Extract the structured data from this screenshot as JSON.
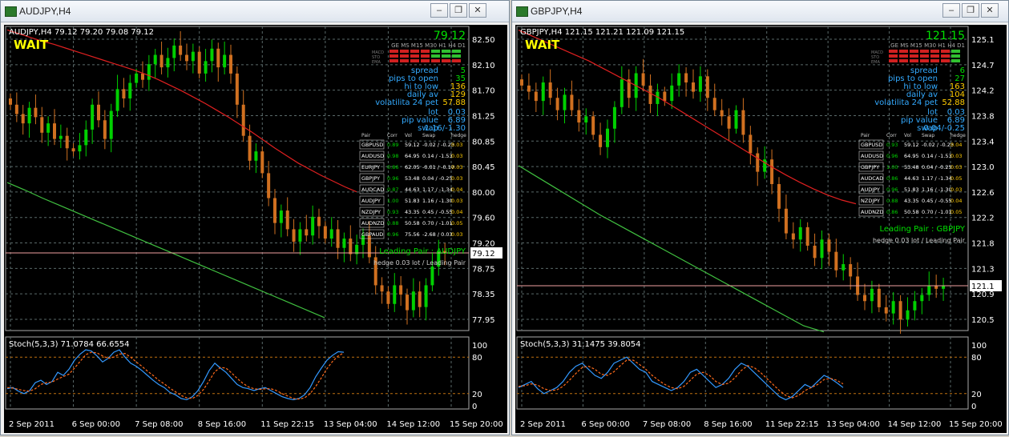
{
  "colors": {
    "bg": "#000000",
    "grid": "#5a6a6a",
    "bull": "#00d000",
    "bear": "#d07020",
    "ma_red": "#e02020",
    "ma_green": "#40c040",
    "stoch_main": "#3399ff",
    "stoch_sig": "#ff6a1a"
  },
  "windows": [
    {
      "title": "AUDJPY,H4",
      "minimize_icon": "minimize-icon",
      "restore_icon": "restore-icon",
      "close_icon": "close-icon",
      "header": "AUDJPY,H4  79.12 79.20 79.08 79.12",
      "wait": "WAIT",
      "bigprice": "79.12",
      "tf_header": "GE MS M15 M30 H1 H4 D1",
      "tf_rows": [
        "MACD",
        "STO",
        "EMA"
      ],
      "stats": [
        [
          "spread",
          "5"
        ],
        [
          "pips to open",
          "35"
        ],
        [
          "hi to low",
          "136"
        ],
        [
          "daily av",
          "129"
        ],
        [
          "volatilita 24 pet",
          "57.88"
        ]
      ],
      "stats2": [
        [
          "lot",
          "0.03"
        ],
        [
          "pip value",
          "6.89"
        ],
        [
          "swap",
          "1.16/-1.30"
        ]
      ],
      "table_headers": [
        "Pair",
        "Corr",
        "Vol",
        "Swap",
        "hedge"
      ],
      "table": [
        [
          "GBPUSD",
          "0.89",
          "59.12",
          "-0.02 / -0.23",
          "0.03"
        ],
        [
          "AUDUSD",
          "0.98",
          "64.95",
          "0.14 / -1.53",
          "0.03"
        ],
        [
          "EURJPY",
          "0.86",
          "62.05",
          "-0.01 / -0.17",
          "0.03"
        ],
        [
          "GBPJPY",
          "0.96",
          "53.48",
          "0.04 / -0.25",
          "0.03"
        ],
        [
          "AUDCAD",
          "0.87",
          "44.63",
          "1.17 / -1.34",
          "0.04"
        ],
        [
          "AUDJPY",
          "1.00",
          "51.83",
          "1.16 / -1.30",
          "0.03"
        ],
        [
          "NZDJPY",
          "0.93",
          "43.35",
          "0.45 / -0.55",
          "0.04"
        ],
        [
          "AUDNZD",
          "0.88",
          "50.58",
          "0.70 / -1.01",
          "0.05"
        ],
        [
          "GBPAUD",
          "0.96",
          "75.56",
          "-2.68 / 0.03",
          "0.03"
        ]
      ],
      "leading": "Leading Pair : AUDJPY",
      "hedge_note": "hedge 0.03 lot / Leading Pair",
      "price_ticks": [
        "82.50",
        "82.10",
        "81.70",
        "81.25",
        "80.85",
        "80.45",
        "80.00",
        "79.60",
        "79.20",
        "78.75",
        "78.35",
        "77.95"
      ],
      "current_price": "79.12",
      "stoch_label": "Stoch(5,3,3) 71.0784 66.6554",
      "stoch_ticks": [
        "100",
        "80",
        "20",
        "0"
      ],
      "time_ticks": [
        "2 Sep 2011",
        "6 Sep 00:00",
        "7 Sep 08:00",
        "8 Sep 16:00",
        "11 Sep 22:15",
        "13 Sep 04:00",
        "14 Sep 12:00",
        "15 Sep 20:00"
      ]
    },
    {
      "title": "GBPJPY,H4",
      "minimize_icon": "minimize-icon",
      "restore_icon": "restore-icon",
      "close_icon": "close-icon",
      "header": "GBPJPY,H4  121.15 121.21 121.09 121.15",
      "wait": "WAIT",
      "bigprice": "121.15",
      "tf_header": "GE MS M15 M30 H1 H4 D1",
      "tf_rows": [
        "MACD",
        "STO",
        "EMA"
      ],
      "stats": [
        [
          "spread",
          "6"
        ],
        [
          "pips to open",
          "27"
        ],
        [
          "hi to low",
          "163"
        ],
        [
          "daily av",
          "104"
        ],
        [
          "volatilita 24 pet",
          "52.88"
        ]
      ],
      "stats2": [
        [
          "lot",
          "0.03"
        ],
        [
          "pip value",
          "6.89"
        ],
        [
          "swap",
          "0.04/-0.25"
        ]
      ],
      "table_headers": [
        "Pair",
        "Corr",
        "Vol",
        "Swap",
        "hedge"
      ],
      "table": [
        [
          "GBPUSD",
          "0.93",
          "59.12",
          "-0.02 / -0.23",
          "0.04"
        ],
        [
          "AUDUSD",
          "0.96",
          "64.95",
          "0.14 / -1.53",
          "0.03"
        ],
        [
          "GBPJPY",
          "1.00",
          "53.48",
          "0.04 / -0.25",
          "0.03"
        ],
        [
          "AUDCAD",
          "0.86",
          "44.63",
          "1.17 / -1.34",
          "0.05"
        ],
        [
          "AUDJPY",
          "0.96",
          "51.83",
          "1.16 / -1.30",
          "0.03"
        ],
        [
          "NZDJPY",
          "0.88",
          "43.35",
          "0.45 / -0.55",
          "0.04"
        ],
        [
          "AUDNZD",
          "0.86",
          "50.58",
          "0.70 / -1.01",
          "0.05"
        ]
      ],
      "leading": "Leading Pair : GBPJPY",
      "hedge_note": "hedge 0.03 lot / Leading Pair",
      "price_ticks": [
        "125.1",
        "124.7",
        "124.2",
        "123.8",
        "123.4",
        "123.0",
        "122.6",
        "122.2",
        "121.8",
        "121.3",
        "120.9",
        "120.5"
      ],
      "current_price": "121.1",
      "stoch_label": "Stoch(5,3,3) 31.1475 39.8054",
      "stoch_ticks": [
        "100",
        "80",
        "20",
        "0"
      ],
      "time_ticks": [
        "2 Sep 2011",
        "6 Sep 00:00",
        "7 Sep 08:00",
        "8 Sep 16:00",
        "11 Sep 22:15",
        "13 Sep 04:00",
        "14 Sep 12:00",
        "15 Sep 20:00"
      ]
    }
  ],
  "chart_data": [
    {
      "type": "candlestick",
      "symbol": "AUDJPY",
      "timeframe": "H4",
      "ylim": [
        77.95,
        82.5
      ],
      "close": [
        81.5,
        81.35,
        81.2,
        81.45,
        81.3,
        81.05,
        81.2,
        80.95,
        81.0,
        80.8,
        80.75,
        80.85,
        81.1,
        81.5,
        81.25,
        80.95,
        81.4,
        81.75,
        81.6,
        81.85,
        82.0,
        81.9,
        82.15,
        82.3,
        82.1,
        82.25,
        82.45,
        82.3,
        82.2,
        82.35,
        82.0,
        82.2,
        82.4,
        82.1,
        82.3,
        82.0,
        81.5,
        81.0,
        80.6,
        80.75,
        80.4,
        80.0,
        79.6,
        79.8,
        79.5,
        79.3,
        79.5,
        79.4,
        79.7,
        79.55,
        79.35,
        79.5,
        79.2,
        79.35,
        79.1,
        79.25,
        79.4,
        79.05,
        78.6,
        78.5,
        78.3,
        78.6,
        78.45,
        78.2,
        78.5,
        78.25,
        78.6,
        78.9,
        79.15,
        79.12
      ],
      "ma_red": [
        82.7,
        82.64,
        82.58,
        82.52,
        82.47,
        82.41,
        82.35,
        82.29,
        82.23,
        82.17,
        82.11,
        82.05,
        81.98,
        81.9,
        81.81,
        81.72,
        81.62,
        81.52,
        81.41,
        81.3,
        81.18,
        81.06,
        80.93,
        80.8,
        80.68,
        80.56,
        80.46,
        80.36,
        80.27,
        80.18,
        80.1
      ],
      "ma_green": [
        80.25,
        80.13,
        80.0,
        79.88,
        79.76,
        79.64,
        79.52,
        79.4,
        79.28,
        79.16,
        79.04,
        78.92,
        78.8,
        78.68,
        78.56,
        78.44,
        78.32,
        78.2,
        78.08
      ],
      "stoch_main": [
        28,
        30,
        24,
        20,
        25,
        38,
        42,
        35,
        40,
        55,
        50,
        60,
        75,
        85,
        92,
        90,
        82,
        72,
        78,
        88,
        92,
        80,
        70,
        65,
        58,
        50,
        42,
        35,
        30,
        22,
        18,
        12,
        10,
        15,
        25,
        40,
        58,
        70,
        62,
        55,
        45,
        35,
        30,
        28,
        25,
        28,
        30,
        25,
        20,
        15,
        12,
        10,
        12,
        18,
        30,
        48,
        62,
        75,
        83,
        89,
        88
      ],
      "stoch_sig": [
        30,
        29,
        27,
        25,
        24,
        28,
        35,
        38,
        39,
        44,
        48,
        52,
        62,
        73,
        84,
        88,
        87,
        82,
        78,
        80,
        85,
        86,
        80,
        72,
        65,
        57,
        50,
        42,
        36,
        29,
        23,
        17,
        13,
        12,
        17,
        27,
        41,
        56,
        63,
        62,
        54,
        45,
        37,
        31,
        28,
        27,
        28,
        28,
        25,
        20,
        16,
        12,
        11,
        13,
        20,
        32,
        46,
        61,
        73,
        82,
        87
      ]
    },
    {
      "type": "candlestick",
      "symbol": "GBPJPY",
      "timeframe": "H4",
      "ylim": [
        120.5,
        125.1
      ],
      "close": [
        124.4,
        124.3,
        124.15,
        124.45,
        124.2,
        124.0,
        124.25,
        124.0,
        123.8,
        123.9,
        123.6,
        123.4,
        123.7,
        124.05,
        124.5,
        124.2,
        124.6,
        124.4,
        124.1,
        124.3,
        124.15,
        124.4,
        124.6,
        124.45,
        124.3,
        124.55,
        124.2,
        124.0,
        123.9,
        123.7,
        124.0,
        123.6,
        123.3,
        123.0,
        123.2,
        122.8,
        122.4,
        122.0,
        121.9,
        122.1,
        121.8,
        121.6,
        121.9,
        121.7,
        121.4,
        121.5,
        121.3,
        121.0,
        120.9,
        121.1,
        120.8,
        120.7,
        120.9,
        120.6,
        120.75,
        120.9,
        121.0,
        121.15,
        121.1,
        121.15
      ],
      "ma_red": [
        125.3,
        125.2,
        125.1,
        125.0,
        124.9,
        124.8,
        124.68,
        124.56,
        124.44,
        124.32,
        124.2,
        124.06,
        123.92,
        123.78,
        123.64,
        123.5,
        123.36,
        123.22,
        123.08,
        122.95,
        122.83,
        122.72,
        122.62,
        122.54,
        122.48
      ],
      "ma_green": [
        123.1,
        122.9,
        122.7,
        122.5,
        122.3,
        122.12,
        121.94,
        121.76,
        121.58,
        121.4,
        121.22,
        121.04,
        120.86,
        120.68,
        120.5,
        120.4
      ],
      "stoch_main": [
        30,
        35,
        40,
        28,
        20,
        25,
        30,
        40,
        55,
        65,
        70,
        60,
        50,
        45,
        55,
        70,
        75,
        80,
        70,
        60,
        55,
        40,
        35,
        30,
        25,
        30,
        40,
        55,
        60,
        50,
        40,
        30,
        35,
        45,
        60,
        70,
        65,
        55,
        45,
        35,
        25,
        15,
        10,
        15,
        25,
        35,
        30,
        40,
        50,
        45,
        38,
        30
      ],
      "stoch_sig": [
        32,
        33,
        36,
        34,
        28,
        25,
        26,
        32,
        42,
        53,
        63,
        65,
        60,
        52,
        50,
        56,
        66,
        75,
        75,
        68,
        60,
        50,
        42,
        35,
        30,
        28,
        32,
        42,
        52,
        55,
        50,
        40,
        35,
        37,
        46,
        58,
        66,
        63,
        55,
        45,
        35,
        25,
        17,
        13,
        17,
        25,
        30,
        35,
        43,
        45,
        42,
        36
      ]
    }
  ]
}
